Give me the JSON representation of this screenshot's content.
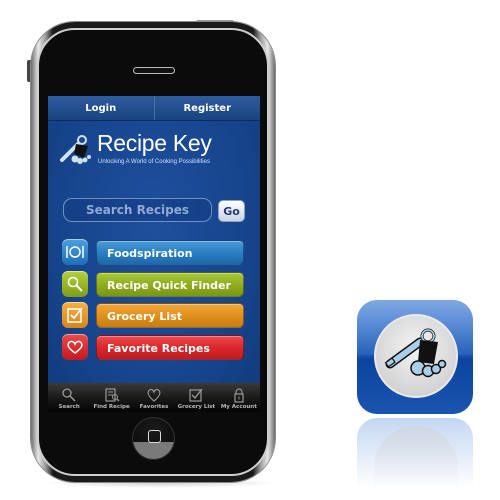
{
  "app": {
    "name": "Recipe Key",
    "tagline": "Unlocking A World of Cooking Possibilities"
  },
  "topbar": {
    "login_label": "Login",
    "register_label": "Register"
  },
  "search": {
    "placeholder": "Search Recipes",
    "value": "",
    "go_label": "Go"
  },
  "menu": [
    {
      "label": "Foodspiration",
      "icon": "plate-fork-knife-icon",
      "color": "#2a7fc4"
    },
    {
      "label": "Recipe Quick Finder",
      "icon": "magnifier-icon",
      "color": "#8fae1f"
    },
    {
      "label": "Grocery List",
      "icon": "checkbox-icon",
      "color": "#e0911c"
    },
    {
      "label": "Favorite Recipes",
      "icon": "heart-icon",
      "color": "#d9282c"
    }
  ],
  "tabbar": [
    {
      "label": "Search",
      "icon": "search-icon"
    },
    {
      "label": "Find Recipe",
      "icon": "find-recipe-icon"
    },
    {
      "label": "Favorites",
      "icon": "heart-icon"
    },
    {
      "label": "Grocery List",
      "icon": "checkbox-icon"
    },
    {
      "label": "My Account",
      "icon": "lock-icon"
    }
  ],
  "colors": {
    "screen_bg": "#17458d",
    "foodspiration": "#2a7fc4",
    "quick_finder": "#8fae1f",
    "grocery": "#e0911c",
    "favorites": "#d9282c"
  }
}
